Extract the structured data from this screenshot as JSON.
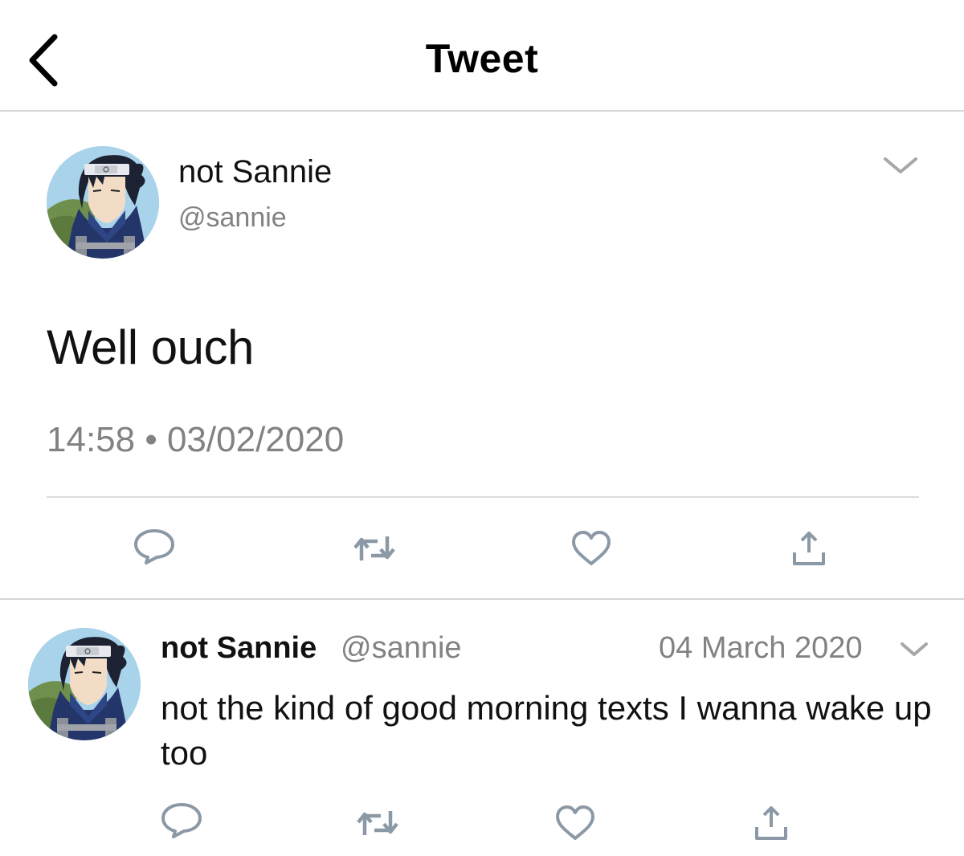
{
  "header": {
    "title": "Tweet",
    "back_icon": "chevron-left-icon"
  },
  "main_tweet": {
    "author_name": "not Sannie",
    "author_handle": "@sannie",
    "text": "Well ouch",
    "timestamp": "14:58 • 03/02/2020",
    "actions": [
      "reply-icon",
      "retweet-icon",
      "like-icon",
      "share-icon"
    ]
  },
  "reply_tweet": {
    "author_name": "not Sannie",
    "author_handle": "@sannie",
    "date": "04 March 2020",
    "text": "not the kind of good morning texts I wanna wake up too",
    "actions": [
      "reply-icon",
      "retweet-icon",
      "like-icon",
      "share-icon"
    ]
  },
  "colors": {
    "text": "#111111",
    "secondary_text": "#828282",
    "icon": "#8b98a5",
    "divider": "#d5d5d5"
  }
}
